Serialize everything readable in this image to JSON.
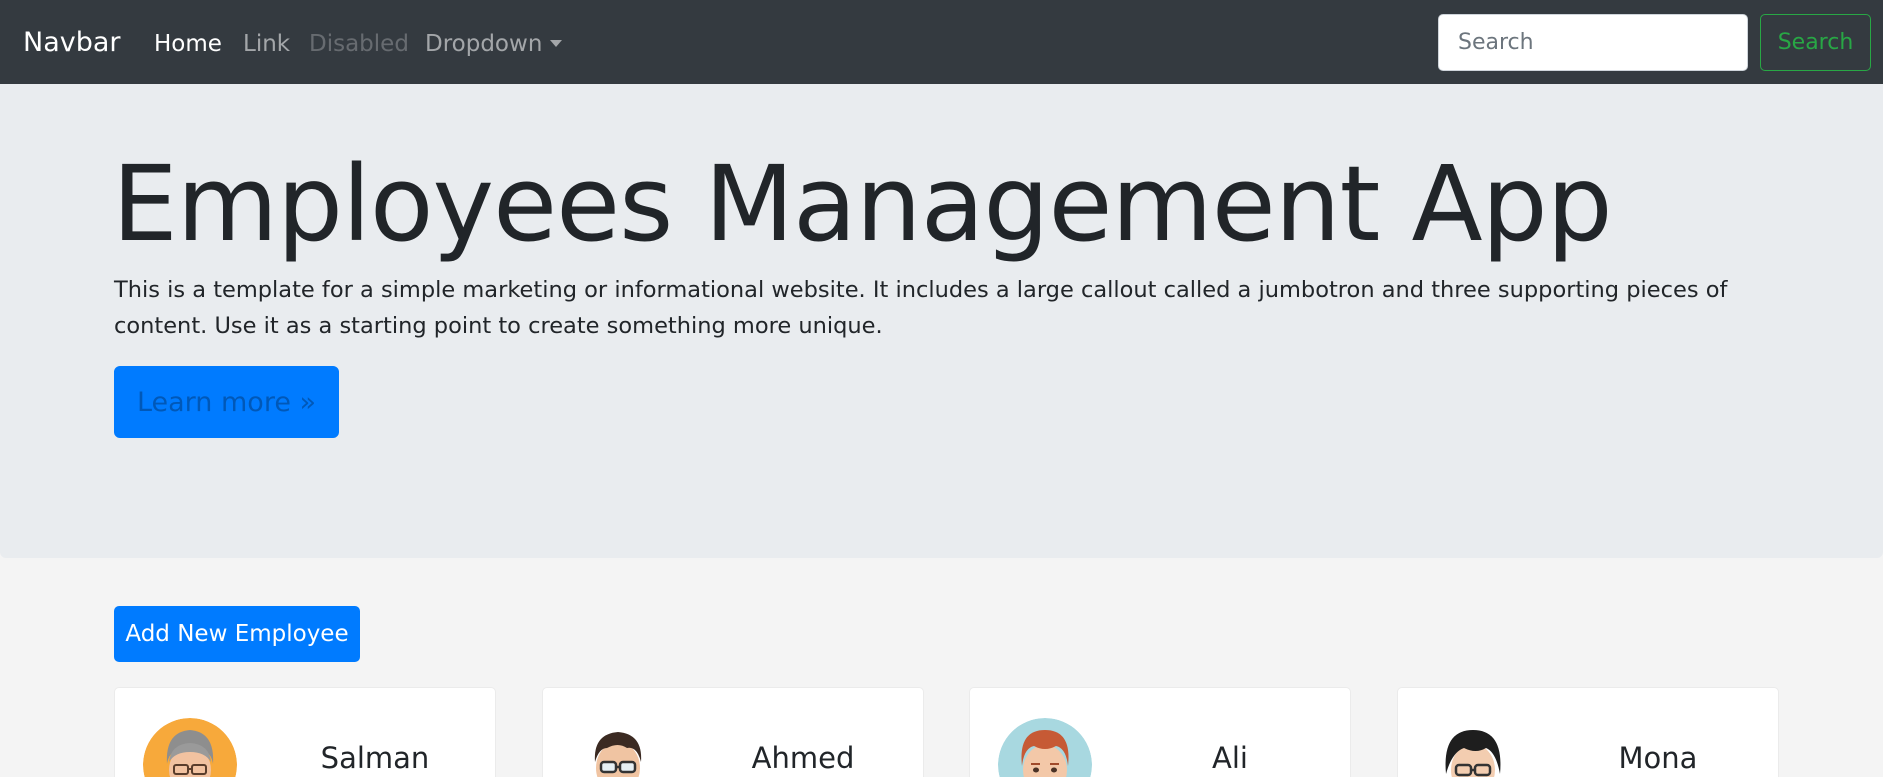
{
  "navbar": {
    "brand": "Navbar",
    "links": [
      {
        "label": "Home",
        "state": "active"
      },
      {
        "label": "Link",
        "state": "normal"
      },
      {
        "label": "Disabled",
        "state": "disabled"
      },
      {
        "label": "Dropdown",
        "state": "dropdown"
      }
    ],
    "search_placeholder": "Search",
    "search_button": "Search",
    "colors": {
      "background": "#343a40",
      "search_accent": "#28a745"
    }
  },
  "jumbotron": {
    "title": "Employees Management App",
    "text": "This is a template for a simple marketing or informational website. It includes a large callout called a jumbotron and three supporting pieces of content. Use it as a starting point to create something more unique.",
    "button": "Learn more »",
    "colors": {
      "background": "#e9ecef",
      "button": "#007bff"
    }
  },
  "main": {
    "add_button": "Add New Employee",
    "employees": [
      {
        "name": "Salman",
        "avatar": "avatar-grey-hair-glasses-icon"
      },
      {
        "name": "Ahmed",
        "avatar": "avatar-dark-hair-glasses-icon"
      },
      {
        "name": "Ali",
        "avatar": "avatar-red-hair-icon"
      },
      {
        "name": "Mona",
        "avatar": "avatar-black-hair-glasses-icon"
      }
    ]
  }
}
